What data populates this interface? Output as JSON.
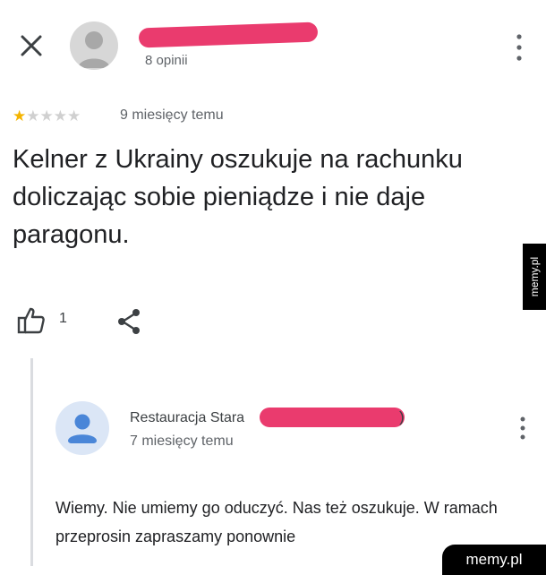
{
  "review": {
    "reviewer_reviews_count": "8 opinii",
    "rating": 1,
    "rating_max": 5,
    "stars": [
      "★",
      "★",
      "★",
      "★",
      "★"
    ],
    "time": "9 miesięcy temu",
    "text": "Kelner z Ukrainy oszukuje na rachunku doliczając sobie pieniądze i nie daje paragonu.",
    "likes": "1"
  },
  "owner_reply": {
    "name": "Restauracja Stara",
    "name_suffix": ")",
    "time": "7 miesięcy temu",
    "text": "Wiemy. Nie umiemy go oduczyć. Nas też oszukuje. W ramach przeprosin zapraszamy ponownie"
  },
  "watermark": {
    "side": "memy.pl",
    "bottom": "memy.pl"
  },
  "colors": {
    "redaction": "#ea3b6e",
    "star_filled": "#f4b400",
    "star_empty": "#d0d0d0"
  },
  "icons": [
    "close-icon",
    "avatar-icon",
    "more-vert-icon",
    "thumb-up-icon",
    "share-icon"
  ]
}
